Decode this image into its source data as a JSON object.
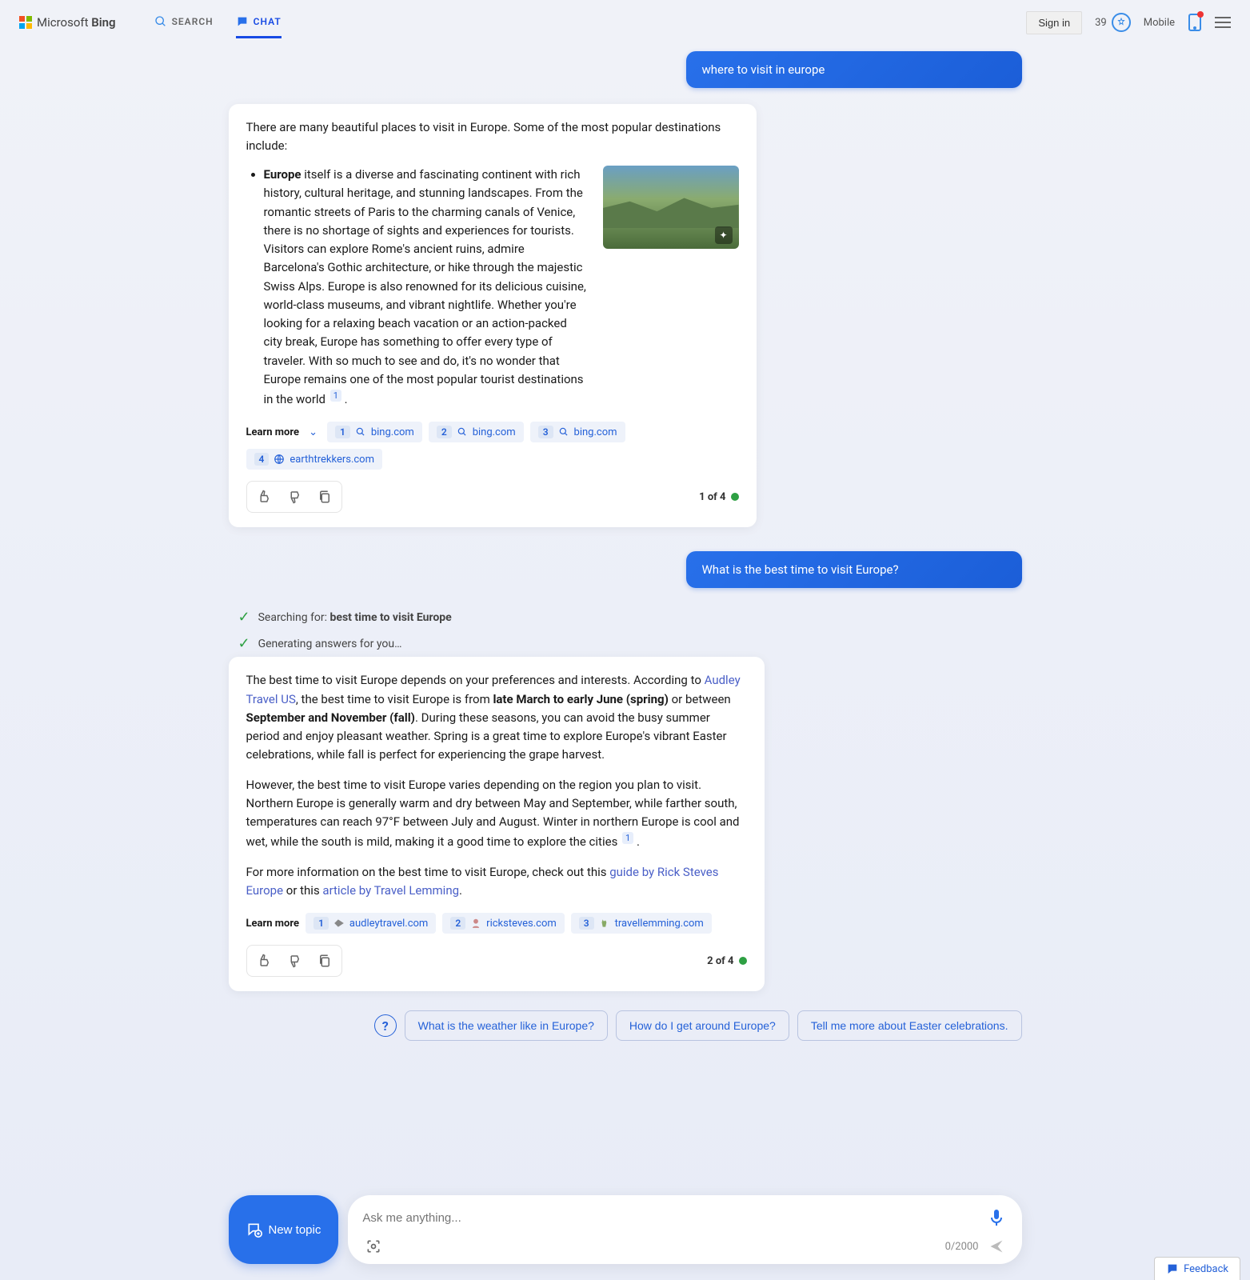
{
  "header": {
    "brand_prefix": "Microsoft",
    "brand_name": "Bing",
    "tabs": {
      "search": "SEARCH",
      "chat": "CHAT"
    },
    "signin": "Sign in",
    "points": "39",
    "mobile": "Mobile"
  },
  "messages": {
    "user1": "where to visit in europe",
    "intro1": "There are many beautiful places to visit in Europe. Some of the most popular destinations include:",
    "li_bold": "Europe",
    "li_rest": " itself is a diverse and fascinating continent with rich history, cultural heritage, and stunning landscapes. From the romantic streets of Paris to the charming canals of Venice, there is no shortage of sights and experiences for tourists. Visitors can explore Rome's ancient ruins, admire Barcelona's Gothic architecture, or hike through the majestic Swiss Alps. Europe is also renowned for its delicious cuisine, world-class museums, and vibrant nightlife. Whether you're looking for a relaxing beach vacation or an action-packed city break, Europe has something to offer every type of traveler. With so much to see and do, it's no wonder that Europe remains one of the most popular tourist destinations in the world ",
    "cite1": "1",
    "li_tail": " .",
    "learn_more": "Learn more",
    "sources1": [
      {
        "n": "1",
        "label": "bing.com",
        "icon": "search"
      },
      {
        "n": "2",
        "label": "bing.com",
        "icon": "search"
      },
      {
        "n": "3",
        "label": "bing.com",
        "icon": "search"
      },
      {
        "n": "4",
        "label": "earthtrekkers.com",
        "icon": "globe"
      }
    ],
    "counter1": "1 of 4",
    "user2": "What is the best time to visit Europe?",
    "status": {
      "searching_prefix": "Searching for: ",
      "searching_term": "best time to visit Europe",
      "generating": "Generating answers for you…"
    },
    "p1_a": "The best time to visit Europe depends on your preferences and interests. According to ",
    "p1_link1": "Audley Travel US",
    "p1_b": ", the best time to visit Europe is from ",
    "p1_bold1": "late March to early June (spring)",
    "p1_c": " or between ",
    "p1_bold2": "September and November (fall)",
    "p1_d": ". During these seasons, you can avoid the busy summer period and enjoy pleasant weather. Spring is a great time to explore Europe's vibrant Easter celebrations, while fall is perfect for experiencing the grape harvest.",
    "p2_a": "However, the best time to visit Europe varies depending on the region you plan to visit. Northern Europe is generally warm and dry between May and September, while farther south, temperatures can reach 97°F between July and August. Winter in northern Europe is cool and wet, while the south is mild, making it a good time to explore the cities ",
    "p2_cite": "1",
    "p2_b": " .",
    "p3_a": "For more information on the best time to visit Europe, check out this ",
    "p3_link1": "guide by Rick Steves Europe",
    "p3_b": " or this ",
    "p3_link2": "article by Travel Lemming",
    "p3_c": ".",
    "sources2": [
      {
        "n": "1",
        "label": "audleytravel.com",
        "icon": "plane"
      },
      {
        "n": "2",
        "label": "ricksteves.com",
        "icon": "face"
      },
      {
        "n": "3",
        "label": "travellemming.com",
        "icon": "llama"
      }
    ],
    "counter2": "2 of 4"
  },
  "suggestions": [
    "What is the weather like in Europe?",
    "How do I get around Europe?",
    "Tell me more about Easter celebrations."
  ],
  "compose": {
    "new_topic": "New topic",
    "placeholder": "Ask me anything...",
    "char_count": "0/2000"
  },
  "feedback": "Feedback"
}
